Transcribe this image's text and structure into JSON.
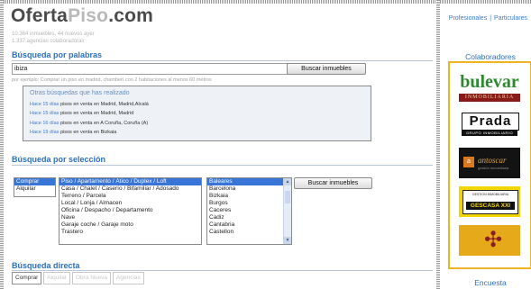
{
  "brand": {
    "name_dark": "Oferta",
    "name_light": "Piso",
    "name_suffix": ".com"
  },
  "stats": {
    "line1": "10.364 inmuebles, 44 nuevos ayer",
    "line2": "1.337 agencias colaboradoras"
  },
  "top_links": {
    "professionals": "Profesionales",
    "separator": "|",
    "individuals": "Particulares"
  },
  "keyword_search": {
    "title": "Búsqueda por palabras",
    "input_value": "ibiza",
    "button_label": "Buscar inmuebles",
    "hint": "por ejemplo: Comprar un piso en madrid, chamberí con 2 habitaciones al menos 60 metros"
  },
  "history": {
    "title": "Otras búsquedas que has realizado",
    "items": [
      {
        "when": "Hace 15 días",
        "text": " pisos en venta en Madrid, Madrid,Alcalá"
      },
      {
        "when": "Hace 15 días",
        "text": " pisos en venta en Madrid, Madrid"
      },
      {
        "when": "Hace 16 días",
        "text": " pisos en venta en A Coruña, Coruña (A)"
      },
      {
        "when": "Hace 19 días",
        "text": " pisos en venta en Bizkaia"
      }
    ]
  },
  "selection_search": {
    "title": "Búsqueda por selección",
    "operations": [
      {
        "label": "Comprar",
        "selected": true
      },
      {
        "label": "Alquilar",
        "selected": false
      }
    ],
    "property_types": [
      {
        "label": "Piso / Apartamento / Ático / Duplex / Loft",
        "selected": true
      },
      {
        "label": "Casa / Chalet / Caserío / Bifamiliar / Adosado",
        "selected": false
      },
      {
        "label": "Terreno / Parcela",
        "selected": false
      },
      {
        "label": "Local / Lonja / Almacen",
        "selected": false
      },
      {
        "label": "Oficina / Despacho / Departamento",
        "selected": false
      },
      {
        "label": "Nave",
        "selected": false
      },
      {
        "label": "Garaje coche / Garaje moto",
        "selected": false
      },
      {
        "label": "Trastero",
        "selected": false
      }
    ],
    "provinces": [
      {
        "label": "Baleares",
        "selected": true
      },
      {
        "label": "Barcelona",
        "selected": false
      },
      {
        "label": "Bizkaia",
        "selected": false
      },
      {
        "label": "Burgos",
        "selected": false
      },
      {
        "label": "Caceres",
        "selected": false
      },
      {
        "label": "Cadiz",
        "selected": false
      },
      {
        "label": "Cantabria",
        "selected": false
      },
      {
        "label": "Castellon",
        "selected": false
      }
    ],
    "button_label": "Buscar inmuebles"
  },
  "direct_search": {
    "title": "Búsqueda directa",
    "tabs": [
      {
        "label": "Comprar",
        "active": true
      },
      {
        "label": "Alquilar",
        "active": false
      },
      {
        "label": "Obra Nueva",
        "active": false
      },
      {
        "label": "Agencias",
        "active": false
      }
    ]
  },
  "sidebar": {
    "title": "Colaboradores",
    "partners": [
      {
        "name": "bulevar",
        "subtitle": "INMOBILIARIA"
      },
      {
        "name": "Prada",
        "subtitle": "GRUPO INMOBILIARIO"
      },
      {
        "name": "antoscar",
        "subtitle": "gestión inmobiliaria"
      },
      {
        "name": "GESCASA XXI",
        "subtitle": "GESTION INMOBILIARIA"
      },
      {
        "name": "cruz"
      }
    ],
    "survey_title": "Encuesta"
  },
  "colors": {
    "accent": "#2d6fbe",
    "selection": "#3875d7",
    "sidebar_border": "#f0b323"
  }
}
